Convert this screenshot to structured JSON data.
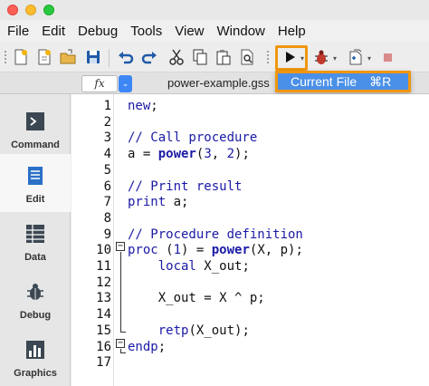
{
  "window": {
    "traffic_lights": [
      "close",
      "minimize",
      "zoom"
    ]
  },
  "menubar": {
    "items": [
      "File",
      "Edit",
      "Debug",
      "Tools",
      "View",
      "Window",
      "Help"
    ]
  },
  "toolbar": {
    "buttons": [
      "new-file",
      "new-from-template",
      "open-folder",
      "save",
      "undo",
      "redo",
      "cut",
      "copy",
      "paste",
      "find",
      "run",
      "debug-bug",
      "step-into",
      "stop"
    ],
    "run_highlight_color": "#f0960e"
  },
  "tabbar": {
    "fx_label": "fx",
    "file_tab": "power-example.gss"
  },
  "dropdown": {
    "item_label": "Current File",
    "shortcut": "⌘R",
    "highlight": "#4a90e8"
  },
  "sidebar": {
    "items": [
      {
        "label": "Command",
        "icon": "terminal-icon"
      },
      {
        "label": "Edit",
        "icon": "document-icon",
        "active": true
      },
      {
        "label": "Data",
        "icon": "table-icon"
      },
      {
        "label": "Debug",
        "icon": "bug-icon"
      },
      {
        "label": "Graphics",
        "icon": "bar-chart-icon"
      }
    ]
  },
  "editor": {
    "line_numbers": [
      "1",
      "2",
      "3",
      "4",
      "5",
      "6",
      "7",
      "8",
      "9",
      "10",
      "11",
      "12",
      "13",
      "14",
      "15",
      "16",
      "17"
    ],
    "lines": [
      "new;",
      "",
      "// Call procedure",
      "a = power(3, 2);",
      "",
      "// Print result",
      "print a;",
      "",
      "// Procedure definition",
      "proc (1) = power(X, p);",
      "    local X_out;",
      "",
      "    X_out = X ^ p;",
      "",
      "    retp(X_out);",
      "endp;",
      ""
    ]
  }
}
